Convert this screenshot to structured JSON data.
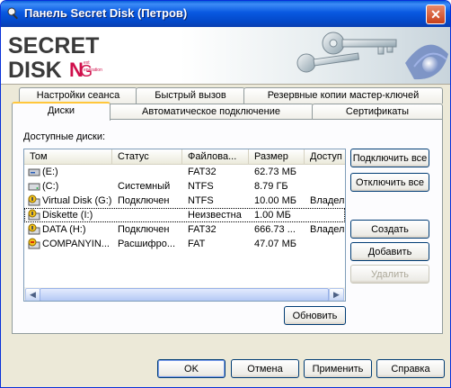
{
  "window": {
    "title": "Панель Secret Disk (Петров)"
  },
  "tabs_back": [
    {
      "label": "Настройки сеанса"
    },
    {
      "label": "Быстрый вызов"
    },
    {
      "label": "Резервные копии мастер-ключей"
    }
  ],
  "tabs_front": [
    {
      "label": "Диски"
    },
    {
      "label": "Автоматическое подключение"
    },
    {
      "label": "Сертификаты"
    }
  ],
  "disks": {
    "group_label": "Доступные диски:",
    "columns": [
      "Том",
      "Статус",
      "Файлова...",
      "Размер",
      "Доступ"
    ],
    "rows": [
      {
        "volume": "(E:)",
        "status": "",
        "fs": "FAT32",
        "size": "62.73 МБ",
        "access": "",
        "icon": "removable-drive-icon"
      },
      {
        "volume": "(C:)",
        "status": "Системный",
        "fs": "NTFS",
        "size": "8.79 ГБ",
        "access": "",
        "icon": "hard-drive-icon"
      },
      {
        "volume": "Virtual Disk (G:)",
        "status": "Подключен",
        "fs": "NTFS",
        "size": "10.00 МБ",
        "access": "Владел",
        "icon": "secret-drive-icon"
      },
      {
        "volume": "Diskette (I:)",
        "status": "",
        "fs": "Неизвестна",
        "size": "1.00 МБ",
        "access": "",
        "icon": "secret-drive-icon"
      },
      {
        "volume": "DATA (H:)",
        "status": "Подключен",
        "fs": "FAT32",
        "size": "666.73 ...",
        "access": "Владел",
        "icon": "secret-drive-icon"
      },
      {
        "volume": "COMPANYIN...",
        "status": "Расшифро...",
        "fs": "FAT",
        "size": "47.07 МБ",
        "access": "",
        "icon": "decrypting-drive-icon"
      }
    ],
    "selected_row": 3
  },
  "side_buttons": {
    "connect_all": "Подключить все",
    "disconnect_all": "Отключить все",
    "create": "Создать",
    "add": "Добавить",
    "delete": "Удалить"
  },
  "refresh_button": "Обновить",
  "footer_buttons": {
    "ok": "OK",
    "cancel": "Отмена",
    "apply": "Применить",
    "help": "Справка"
  },
  "colors": {
    "titlebar": "#0858e0",
    "accent_tab": "#ffc73c"
  }
}
